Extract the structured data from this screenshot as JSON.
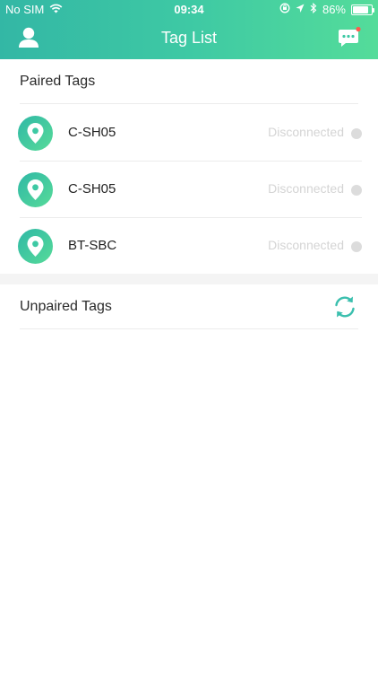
{
  "status_bar": {
    "carrier": "No SIM",
    "time": "09:34",
    "battery": "86%",
    "battery_level": 0.86
  },
  "nav": {
    "title": "Tag List",
    "left_icon": "user-icon",
    "right_icon": "chat-bubble-icon",
    "notification_dot_color": "#ff5a4e"
  },
  "paired": {
    "title": "Paired Tags",
    "tags": [
      {
        "name": "C-SH05",
        "status": "Disconnected"
      },
      {
        "name": "C-SH05",
        "status": "Disconnected"
      },
      {
        "name": "BT-SBC",
        "status": "Disconnected"
      }
    ]
  },
  "unpaired": {
    "title": "Unpaired Tags",
    "refresh_icon": "refresh-icon"
  },
  "colors": {
    "accent": "#3ec9a4",
    "accent_dark": "#33b7a5",
    "accent_light": "#54dc9a",
    "refresh_icon": "#3bbfae"
  }
}
